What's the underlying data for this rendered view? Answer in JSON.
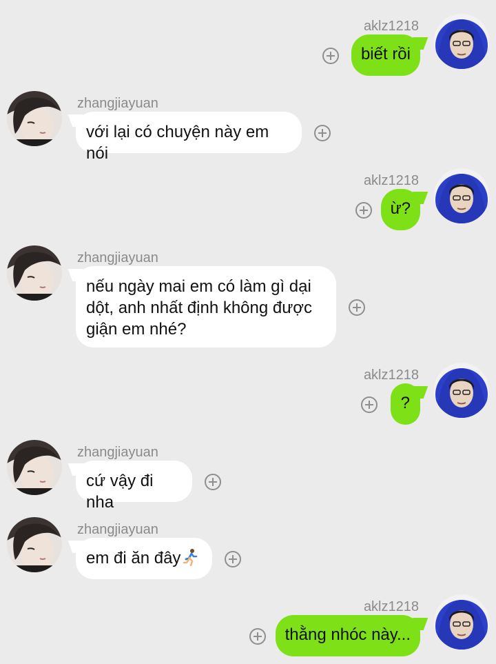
{
  "messages": [
    {
      "side": "right",
      "sender": "aklz1218",
      "text": "biết rồi"
    },
    {
      "side": "left",
      "sender": "zhangjiayuan",
      "text": "với lại có chuyện này em nói"
    },
    {
      "side": "right",
      "sender": "aklz1218",
      "text": "ừ?"
    },
    {
      "side": "left",
      "sender": "zhangjiayuan",
      "text": "nếu ngày mai em có làm gì dại dột, anh nhất định không được giận em nhé?"
    },
    {
      "side": "right",
      "sender": "aklz1218",
      "text": "?"
    },
    {
      "side": "left",
      "sender": "zhangjiayuan",
      "text": "cứ vậy đi nha"
    },
    {
      "side": "left",
      "sender": "zhangjiayuan",
      "text": "em đi ăn đây",
      "emoji": "running-person-icon"
    },
    {
      "side": "right",
      "sender": "aklz1218",
      "text": "thằng nhóc này..."
    }
  ],
  "colors": {
    "background": "#ebebeb",
    "outgoing_bubble": "#7ee016",
    "incoming_bubble": "#ffffff",
    "sender_name": "#8a8a8a"
  }
}
